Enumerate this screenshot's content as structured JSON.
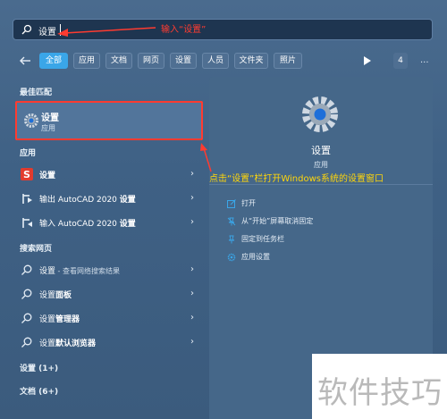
{
  "search": {
    "query": "设置"
  },
  "annotations": {
    "search_hint": "输入“设置”",
    "settings_hint": "点击“设置”栏打开Windows系统的设置窗口"
  },
  "filters": {
    "chips": [
      "全部",
      "应用",
      "文档",
      "网页",
      "设置",
      "人员",
      "文件夹",
      "照片"
    ],
    "count": "4",
    "more": "..."
  },
  "left": {
    "best_match_header": "最佳匹配",
    "best_match": {
      "title": "设置",
      "subtitle": "应用"
    },
    "apps_header": "应用",
    "apps": [
      {
        "label": "设置",
        "icon": "s-app-icon"
      },
      {
        "label_prefix": "输出 AutoCAD 2020 ",
        "label_bold": "设置",
        "icon": "autocad-icon"
      },
      {
        "label_prefix": "输入 AutoCAD 2020 ",
        "label_bold": "设置",
        "icon": "autocad-icon"
      }
    ],
    "web_header": "搜索网页",
    "web": [
      {
        "prefix": "设置",
        "suffix": " - 查看网络搜索结果"
      },
      {
        "prefix": "设置",
        "bold": "面板"
      },
      {
        "prefix": "设置",
        "bold": "管理器"
      },
      {
        "prefix": "设置",
        "bold": "默认浏览器"
      }
    ],
    "settings_group": "设置 (1+)",
    "documents_group": "文档 (6+)"
  },
  "detail": {
    "title": "设置",
    "subtitle": "应用",
    "actions": [
      "打开",
      "从“开始”屏幕取消固定",
      "固定到任务栏",
      "应用设置"
    ]
  },
  "watermark": "软件技巧",
  "colors": {
    "accent": "#3aa6e8",
    "annotation_red": "#ff3b30",
    "annotation_yellow": "#ffd60a"
  }
}
